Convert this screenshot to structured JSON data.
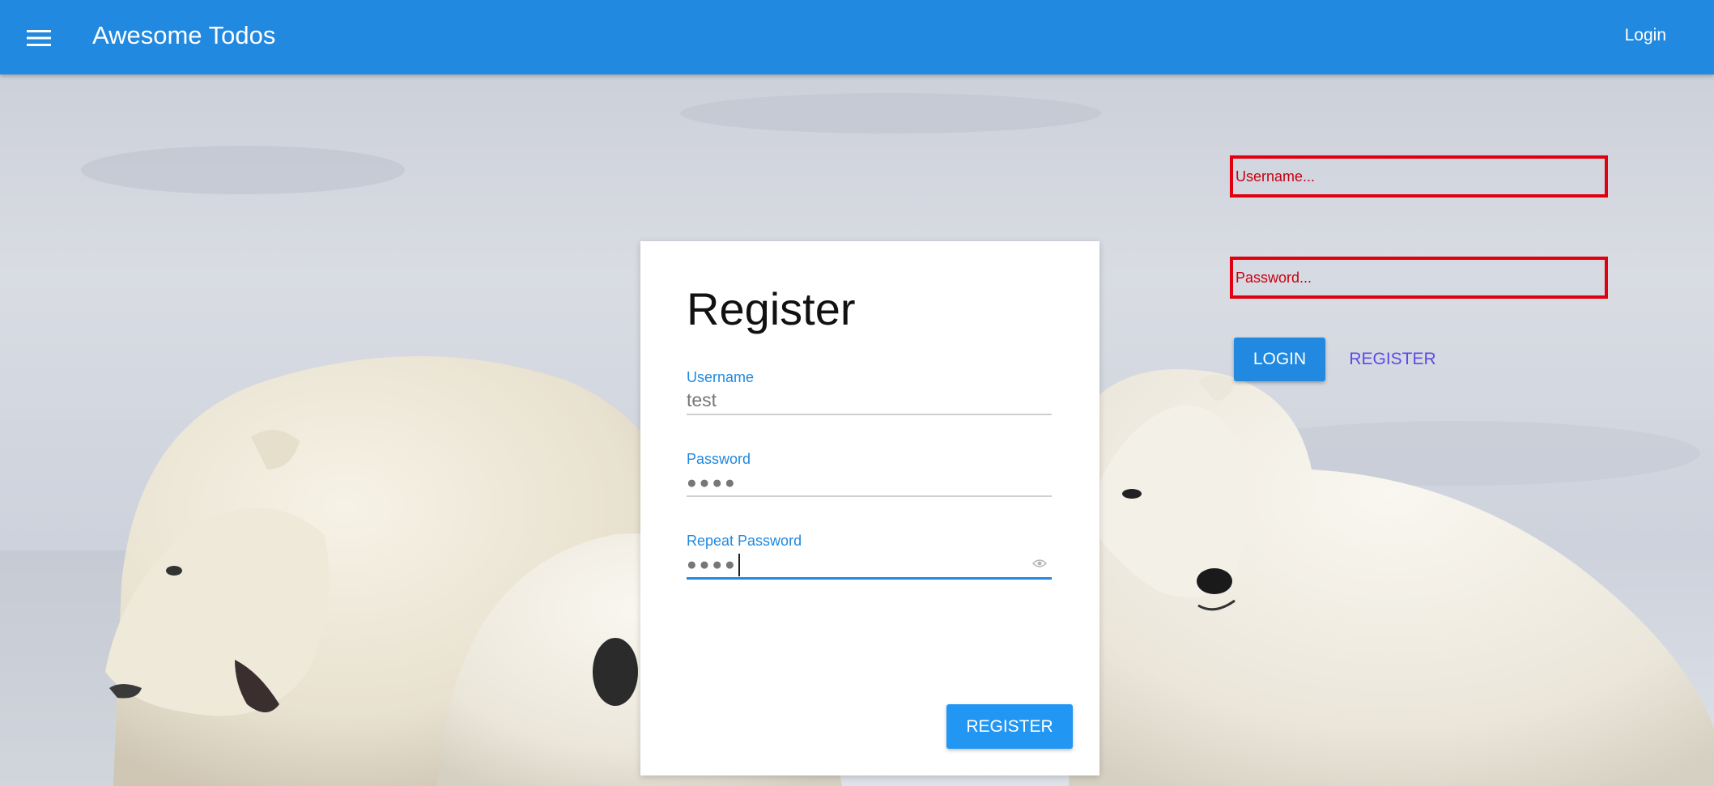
{
  "appbar": {
    "title": "Awesome Todos",
    "login_label": "Login",
    "background": "#2189df"
  },
  "side_form": {
    "username_placeholder": "Username...",
    "password_placeholder": "Password...",
    "login_label": "LOGIN",
    "register_label": "REGISTER",
    "error_color": "#e00010"
  },
  "register_card": {
    "title": "Register",
    "username": {
      "label": "Username",
      "value": "test"
    },
    "password": {
      "label": "Password",
      "value": "●●●●"
    },
    "repeat_password": {
      "label": "Repeat Password",
      "value": "●●●●"
    },
    "submit_label": "REGISTER"
  },
  "icons": {
    "menu": "hamburger-menu-icon",
    "eye": "eye-icon"
  }
}
